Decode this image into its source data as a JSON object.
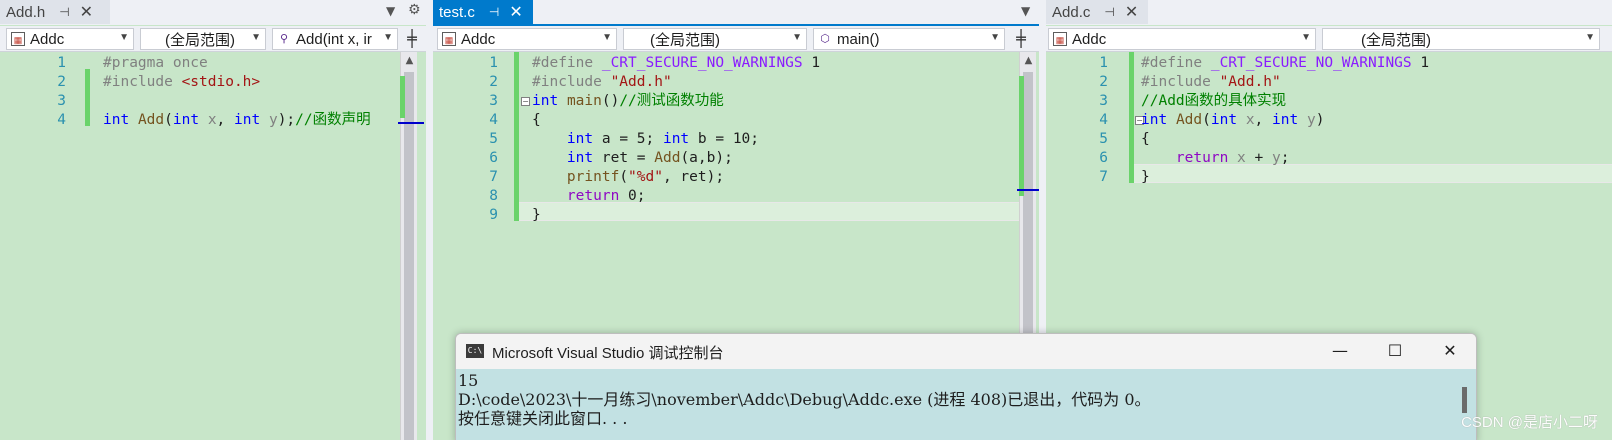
{
  "panes": [
    {
      "tab": {
        "name": "Add.h",
        "pin": "⊣",
        "close": "✕"
      },
      "nav": {
        "project": "Addc",
        "scope": "(全局范围)",
        "member": "Add(int x, ir"
      },
      "lines": [
        {
          "num": "1",
          "segments": [
            {
              "t": "#pragma once",
              "c": "pp"
            }
          ]
        },
        {
          "num": "2",
          "segments": [
            {
              "t": "#include ",
              "c": "pp"
            },
            {
              "t": "<stdio.h>",
              "c": "str"
            }
          ]
        },
        {
          "num": "3",
          "segments": []
        },
        {
          "num": "4",
          "segments": [
            {
              "t": "int",
              "c": "kw"
            },
            {
              "t": " ",
              "c": ""
            },
            {
              "t": "Add",
              "c": "fn"
            },
            {
              "t": "(",
              "c": ""
            },
            {
              "t": "int",
              "c": "kw"
            },
            {
              "t": " ",
              "c": ""
            },
            {
              "t": "x",
              "c": "par"
            },
            {
              "t": ", ",
              "c": ""
            },
            {
              "t": "int",
              "c": "kw"
            },
            {
              "t": " ",
              "c": ""
            },
            {
              "t": "y",
              "c": "par"
            },
            {
              "t": ");",
              "c": ""
            },
            {
              "t": "//函数声明",
              "c": "cm"
            }
          ]
        }
      ]
    },
    {
      "tab": {
        "name": "test.c",
        "pin": "⊣",
        "close": "✕"
      },
      "nav": {
        "project": "Addc",
        "scope": "(全局范围)",
        "member": "main()"
      },
      "lines": [
        {
          "num": "1",
          "segments": [
            {
              "t": "#define ",
              "c": "pp"
            },
            {
              "t": "_CRT_SECURE_NO_WARNINGS",
              "c": "mac"
            },
            {
              "t": " 1",
              "c": ""
            }
          ]
        },
        {
          "num": "2",
          "segments": [
            {
              "t": "#include ",
              "c": "pp"
            },
            {
              "t": "\"Add.h\"",
              "c": "str"
            }
          ]
        },
        {
          "num": "3",
          "segments": [
            {
              "t": "int",
              "c": "kw"
            },
            {
              "t": " ",
              "c": ""
            },
            {
              "t": "main",
              "c": "fn"
            },
            {
              "t": "()",
              "c": ""
            },
            {
              "t": "//测试函数功能",
              "c": "cm"
            }
          ]
        },
        {
          "num": "4",
          "segments": [
            {
              "t": "{",
              "c": ""
            }
          ]
        },
        {
          "num": "5",
          "segments": [
            {
              "t": "    ",
              "c": ""
            },
            {
              "t": "int",
              "c": "kw"
            },
            {
              "t": " a = 5; ",
              "c": ""
            },
            {
              "t": "int",
              "c": "kw"
            },
            {
              "t": " b = 10;",
              "c": ""
            }
          ]
        },
        {
          "num": "6",
          "segments": [
            {
              "t": "    ",
              "c": ""
            },
            {
              "t": "int",
              "c": "kw"
            },
            {
              "t": " ret = ",
              "c": ""
            },
            {
              "t": "Add",
              "c": "fn"
            },
            {
              "t": "(a,b);",
              "c": ""
            }
          ]
        },
        {
          "num": "7",
          "segments": [
            {
              "t": "    ",
              "c": ""
            },
            {
              "t": "printf",
              "c": "fn"
            },
            {
              "t": "(",
              "c": ""
            },
            {
              "t": "\"%d\"",
              "c": "str"
            },
            {
              "t": ", ret);",
              "c": ""
            }
          ]
        },
        {
          "num": "8",
          "segments": [
            {
              "t": "    ",
              "c": ""
            },
            {
              "t": "return",
              "c": "ctl"
            },
            {
              "t": " 0;",
              "c": ""
            }
          ]
        },
        {
          "num": "9",
          "segments": [
            {
              "t": "}",
              "c": ""
            }
          ]
        }
      ]
    },
    {
      "tab": {
        "name": "Add.c",
        "pin": "⊣",
        "close": "✕"
      },
      "nav": {
        "project": "Addc",
        "scope": "(全局范围)"
      },
      "lines": [
        {
          "num": "1",
          "segments": [
            {
              "t": "#define ",
              "c": "pp"
            },
            {
              "t": "_CRT_SECURE_NO_WARNINGS",
              "c": "mac"
            },
            {
              "t": " 1",
              "c": ""
            }
          ]
        },
        {
          "num": "2",
          "segments": [
            {
              "t": "#include ",
              "c": "pp"
            },
            {
              "t": "\"Add.h\"",
              "c": "str"
            }
          ]
        },
        {
          "num": "3",
          "segments": [
            {
              "t": "//Add函数的具体实现",
              "c": "cm"
            }
          ]
        },
        {
          "num": "4",
          "segments": [
            {
              "t": "int",
              "c": "kw"
            },
            {
              "t": " ",
              "c": ""
            },
            {
              "t": "Add",
              "c": "fn"
            },
            {
              "t": "(",
              "c": ""
            },
            {
              "t": "int",
              "c": "kw"
            },
            {
              "t": " ",
              "c": ""
            },
            {
              "t": "x",
              "c": "par"
            },
            {
              "t": ", ",
              "c": ""
            },
            {
              "t": "int",
              "c": "kw"
            },
            {
              "t": " ",
              "c": ""
            },
            {
              "t": "y",
              "c": "par"
            },
            {
              "t": ")",
              "c": ""
            }
          ]
        },
        {
          "num": "5",
          "segments": [
            {
              "t": "{",
              "c": ""
            }
          ]
        },
        {
          "num": "6",
          "segments": [
            {
              "t": "    ",
              "c": ""
            },
            {
              "t": "return",
              "c": "ctl"
            },
            {
              "t": " ",
              "c": ""
            },
            {
              "t": "x",
              "c": "par"
            },
            {
              "t": " + ",
              "c": ""
            },
            {
              "t": "y",
              "c": "par"
            },
            {
              "t": ";",
              "c": ""
            }
          ]
        },
        {
          "num": "7",
          "segments": [
            {
              "t": "}",
              "c": ""
            }
          ]
        }
      ]
    }
  ],
  "console": {
    "title": "Microsoft Visual Studio 调试控制台",
    "icon_text": "C:\\",
    "minimize": "—",
    "maximize": "☐",
    "close": "✕",
    "output": [
      "15",
      "D:\\code\\2023\\十一月练习\\november\\Addc\\Debug\\Addc.exe (进程 408)已退出，代码为 0。",
      "按任意键关闭此窗口. . ."
    ]
  },
  "watermark": "CSDN @是店小二呀",
  "colors": {
    "editor_bg": "#c8e6c9",
    "accent": "#007acc",
    "console_bg": "#c2e1e3"
  }
}
